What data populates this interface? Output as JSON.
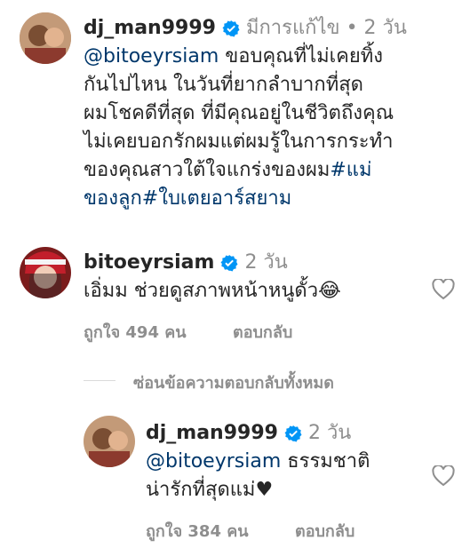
{
  "comment1": {
    "username": "dj_man9999",
    "edited_label": "มีการแก้ไข",
    "dot": "•",
    "time": "2 วัน",
    "lines": [
      {
        "mention": "@bitoeyrsiam",
        "text": " ขอบคุณที่ไม่เคยทิ้ง"
      },
      {
        "text": "กันไปไหน ในวันที่ยากลำบากที่สุด"
      },
      {
        "text": "ผมโชคดีที่สุด ที่มีคุณอยู่ในชีวิตถึงคุณ"
      },
      {
        "text": "ไม่เคยบอกรักผมแต่ผมรู้ในการกระทำ"
      },
      {
        "text": "ของคุณสาวใต้ใจแกร่งของผม",
        "tag": "#แม่"
      },
      {
        "tag": "ของลูก#ใบเตยอาร์สยาม"
      }
    ]
  },
  "comment2": {
    "username": "bitoeyrsiam",
    "time": "2 วัน",
    "text": "เอิ่มม ช่วยดูสภาพหน้าหนูดั้ว",
    "emoji": "😂",
    "likes": "ถูกใจ 494 คน",
    "reply": "ตอบกลับ"
  },
  "hide_replies": "ซ่อนข้อความตอบกลับทั้งหมด",
  "comment3": {
    "username": "dj_man9999",
    "time": "2 วัน",
    "mention": "@bitoeyrsiam",
    "text1": " ธรรมชาติ",
    "text2": "น่ารักที่สุดแม่",
    "heart": "♥",
    "likes": "ถูกใจ 384 คน",
    "reply": "ตอบกลับ"
  },
  "colors": {
    "text": "#262626",
    "secondary": "#8e8e8e",
    "link": "#00376b",
    "verified": "#0095f6"
  }
}
